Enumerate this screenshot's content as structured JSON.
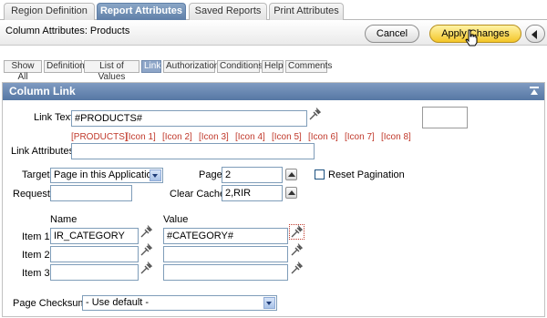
{
  "tabs": [
    {
      "label": "Region Definition"
    },
    {
      "label": "Report Attributes",
      "active": true
    },
    {
      "label": "Saved Reports"
    },
    {
      "label": "Print Attributes"
    }
  ],
  "header": {
    "title": "Column Attributes: Products",
    "cancel_label": "Cancel",
    "apply_label": "Apply Changes"
  },
  "subtabs": [
    "Show All",
    "Definition",
    "List of Values",
    "Link",
    "Authorization",
    "Conditions",
    "Help",
    "Comments"
  ],
  "region": {
    "title": "Column Link",
    "link_text_label": "Link Text",
    "link_text_value": "#PRODUCTS#",
    "substitutions": [
      "[PRODUCTS]",
      "[Icon 1]",
      "[Icon 2]",
      "[Icon 3]",
      "[Icon 4]",
      "[Icon 5]",
      "[Icon 6]",
      "[Icon 7]",
      "[Icon 8]"
    ],
    "link_attributes_label": "Link Attributes",
    "link_attributes_value": "",
    "target_label": "Target",
    "target_value": "Page in this Application",
    "page_label": "Page",
    "page_value": "2",
    "reset_pagination_label": "Reset Pagination",
    "reset_pagination_checked": false,
    "request_label": "Request",
    "request_value": "",
    "clear_cache_label": "Clear Cache",
    "clear_cache_value": "2,RIR",
    "name_header": "Name",
    "value_header": "Value",
    "items": [
      {
        "label": "Item 1",
        "name": "IR_CATEGORY",
        "value": "#CATEGORY#"
      },
      {
        "label": "Item 2",
        "name": "",
        "value": ""
      },
      {
        "label": "Item 3",
        "name": "",
        "value": ""
      }
    ],
    "page_checksum_label": "Page Checksum",
    "page_checksum_value": "- Use default -"
  },
  "colors": {
    "region_header": "#5677a4",
    "apply_button": "#f4c628",
    "substitution_text": "#c0392b"
  }
}
